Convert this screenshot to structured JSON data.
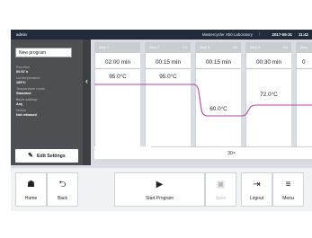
{
  "status_bar": {
    "user": "admin",
    "device_name": "Mastercycler X50 Laboratory",
    "separator": "|",
    "date": "2017-05-31",
    "time": "11:42"
  },
  "side_panel": {
    "program_name": "New program",
    "collapse_icon": "chevron-left-icon",
    "fields": [
      {
        "label": "Run time",
        "value": "00:57 h"
      },
      {
        "label": "Lid temperature",
        "value": "105°C"
      },
      {
        "label": "Temperature mode",
        "value": "Standard"
      },
      {
        "label": "Block settings",
        "value": "Any"
      },
      {
        "label": "Status",
        "value": "Not released"
      }
    ],
    "edit_button": {
      "label": "Edit Settings",
      "icon": "pencil-icon"
    }
  },
  "steps": [
    {
      "name": "Step 1",
      "count": "",
      "duration": "02:00 min",
      "temperature": "95.0°C"
    },
    {
      "name": "Step 2",
      "count": "1/3",
      "duration": "00:15 min",
      "temperature": "95.0°C"
    },
    {
      "name": "Step 3",
      "count": "2/3",
      "duration": "00:15 min",
      "temperature": "60.0°C"
    },
    {
      "name": "Step 4",
      "count": "3/3",
      "duration": "00:30 min",
      "temperature": "72.0°C"
    },
    {
      "name": "Step",
      "count": "",
      "duration": "0",
      "temperature": ""
    }
  ],
  "cycles_label": "30×",
  "curve_color": "#b0479c",
  "toolbar": {
    "home": {
      "label": "Home",
      "icon": "home-icon"
    },
    "back": {
      "label": "Back",
      "icon": "back-arrow-icon"
    },
    "start": {
      "label": "Start Program",
      "icon": "play-icon"
    },
    "save": {
      "label": "Save",
      "icon": "save-icon"
    },
    "logout": {
      "label": "Logout",
      "icon": "logout-icon"
    },
    "menu": {
      "label": "Menu",
      "icon": "menu-icon"
    }
  }
}
